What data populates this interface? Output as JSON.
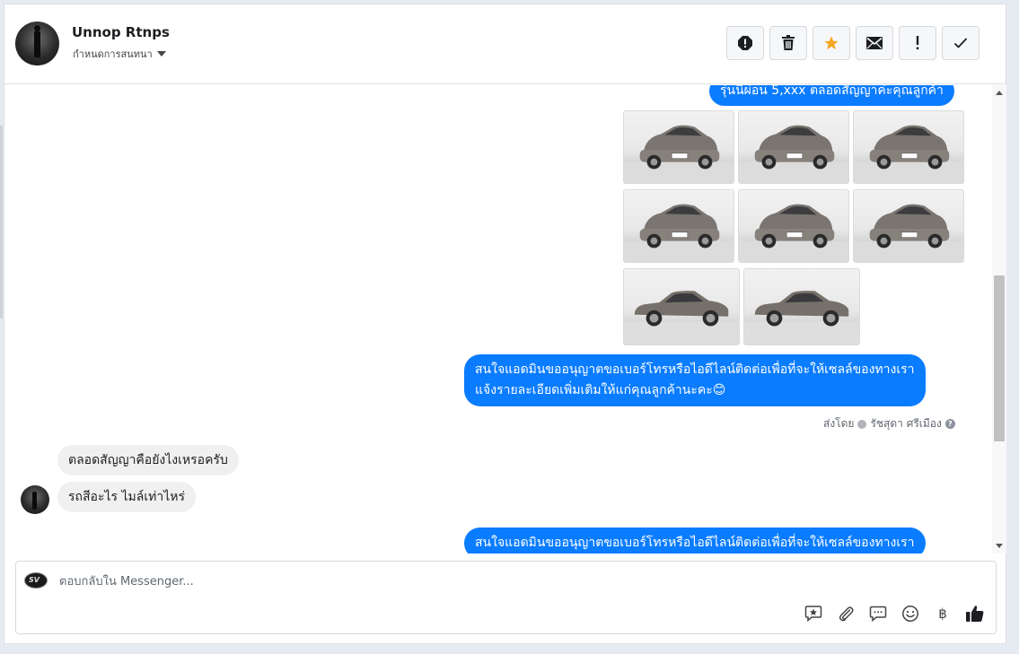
{
  "header": {
    "name": "Unnop Rtnps",
    "subtitle": "กำหนดการสนทนา"
  },
  "actions": [
    "alert-icon",
    "trash-icon",
    "star-icon",
    "mail-icon",
    "exclamation-icon",
    "check-icon"
  ],
  "colors": {
    "accent": "#0a7cff",
    "star": "#f5a623"
  },
  "conversation": {
    "msg_top": "รุ่นนี้ผ่อน 5,xxx ตลอดสัญญาค่ะคุณลูกค้า",
    "msg_admin_line1": "สนใจแอดมินขออนุญาตขอเบอร์โทรหรือไอดีไลน์ติดต่อเพื่อที่จะให้เซลล์ของทางเรา",
    "msg_admin_line2": "แจ้งรายละเอียดเพิ่มเติมให้แก่คุณลูกค้านะคะ😊",
    "sent_by_prefix": "ส่งโดย",
    "sent_by_name": "รัชสุดา ศรีเมือง",
    "incoming_1": "ตลอดสัญญาคือยังไงเหรอครับ",
    "incoming_2": "รถสีอะไร ไมล์เท่าไหร่",
    "msg_admin_repeat": "สนใจแอดมินขออนุญาตขอเบอร์โทรหรือไอดีไลน์ติดต่อเพื่อที่จะให้เซลล์ของทางเรา"
  },
  "composer": {
    "placeholder": "ตอบกลับใน Messenger...",
    "currency_symbol": "฿"
  }
}
